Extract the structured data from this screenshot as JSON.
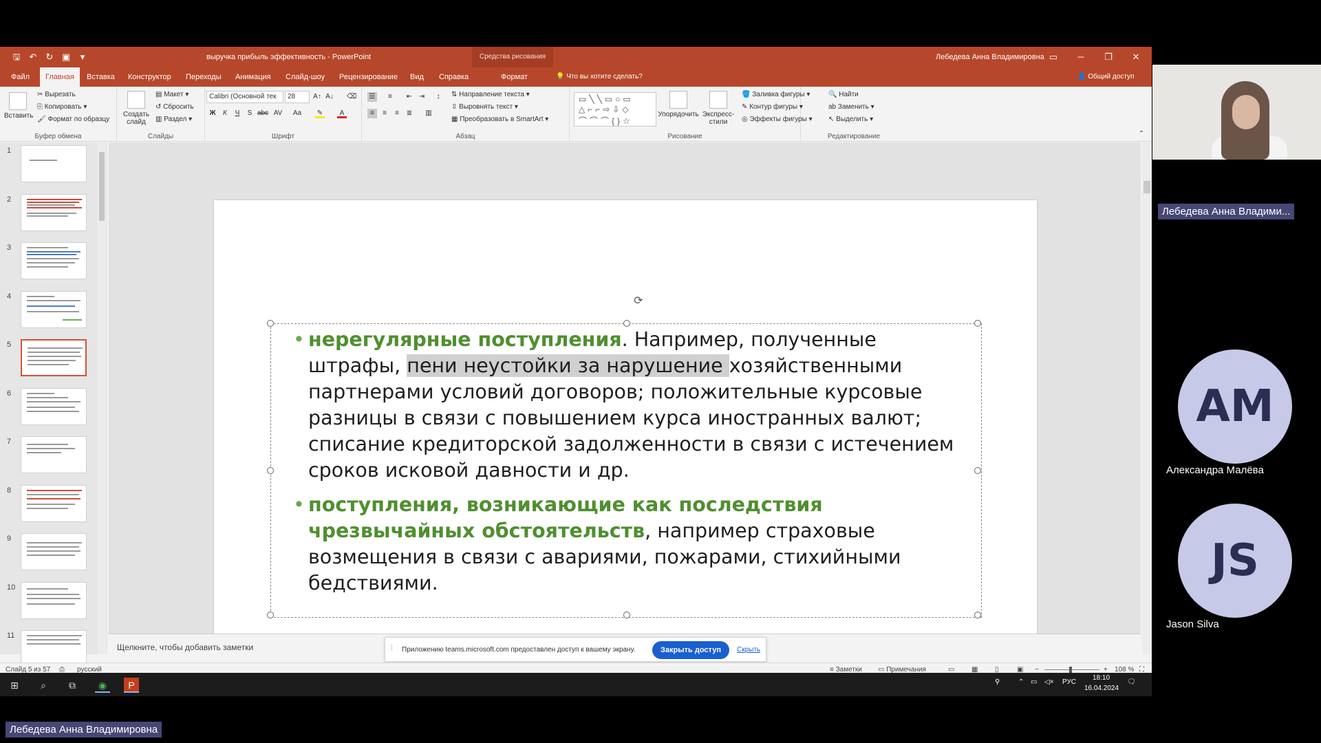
{
  "ppt": {
    "doc_title": "выручка прибыль эффективность - PowerPoint",
    "context_tab": "Средства рисования",
    "user": "Лебедева Анна Владимировна",
    "tabs": [
      "Файл",
      "Главная",
      "Вставка",
      "Конструктор",
      "Переходы",
      "Анимация",
      "Слайд-шоу",
      "Рецензирование",
      "Вид",
      "Справка",
      "Формат"
    ],
    "tell_me": "Что вы хотите сделать?",
    "share": "Общий доступ"
  },
  "ribbon": {
    "clipboard": {
      "label": "Буфер обмена",
      "paste": "Вставить",
      "cut": "Вырезать",
      "copy": "Копировать",
      "format_painter": "Формат по образцу"
    },
    "slides": {
      "label": "Слайды",
      "new_slide": "Создать слайд",
      "layout": "Макет",
      "reset": "Сбросить",
      "section": "Раздел"
    },
    "font": {
      "label": "Шрифт",
      "font_name": "Calibri (Основной тек",
      "font_size": "28",
      "bold": "Ж",
      "italic": "К",
      "underline": "Ч",
      "shadow": "S",
      "strike": "abc",
      "spacing": "AV",
      "case": "Aa"
    },
    "paragraph": {
      "label": "Абзац",
      "text_direction": "Направление текста",
      "align_text": "Выровнять текст",
      "smartart": "Преобразовать в SmartArt"
    },
    "drawing": {
      "label": "Рисование",
      "arrange": "Упорядочить",
      "quick_styles": "Экспресс-стили",
      "fill": "Заливка фигуры",
      "outline": "Контур фигуры",
      "effects": "Эффекты фигуры"
    },
    "editing": {
      "label": "Редактирование",
      "find": "Найти",
      "replace": "Заменить",
      "select": "Выделить"
    }
  },
  "thumbnails": [
    "1",
    "2",
    "3",
    "4",
    "5",
    "6",
    "7",
    "8",
    "9",
    "10",
    "11"
  ],
  "active_slide": 5,
  "slide": {
    "item1": {
      "highlight": "нерегулярные поступления",
      "text_a": ". Например, полученные штрафы, ",
      "selected": "пени неустойки за нарушение ",
      "text_b": "хозяйственными партнерами условий договоров; положительные курсовые разницы в связи с повышением курса иностранных валют; списание кредиторской задолженности в связи с истечением сроков исковой давности и др."
    },
    "item2": {
      "highlight": "поступления, возникающие как последствия чрезвычайных обстоятельств",
      "text": ", например страховые возмещения в связи с авариями, пожарами, стихийными бедствиями."
    }
  },
  "notes_placeholder": "Щелкните, чтобы добавить заметки",
  "sharing_bar": {
    "message": "Приложению teams.microsoft.com предоставлен доступ к вашему экрану.",
    "stop_button": "Закрыть доступ",
    "hide_link": "Скрыть"
  },
  "status": {
    "slide_counter": "Слайд 5 из 57",
    "language": "русский",
    "notes": "Заметки",
    "comments": "Примечания",
    "zoom": "108 %"
  },
  "taskbar": {
    "lang": "РУС",
    "time": "18:10",
    "date": "16.04.2024"
  },
  "teams": {
    "presenter_badge": "Лебедева Анна Владими...",
    "participants": [
      {
        "initials": "АМ",
        "name": "Александра Малёва"
      },
      {
        "initials": "JS",
        "name": "Jason Silva"
      }
    ],
    "bottom_badge": "Лебедева Анна Владимировна"
  },
  "colors": {
    "ppt_accent": "#b7472a",
    "bullet_highlight": "#4f8f2f",
    "teams_badge": "#464775",
    "share_button": "#1a5fd0"
  }
}
